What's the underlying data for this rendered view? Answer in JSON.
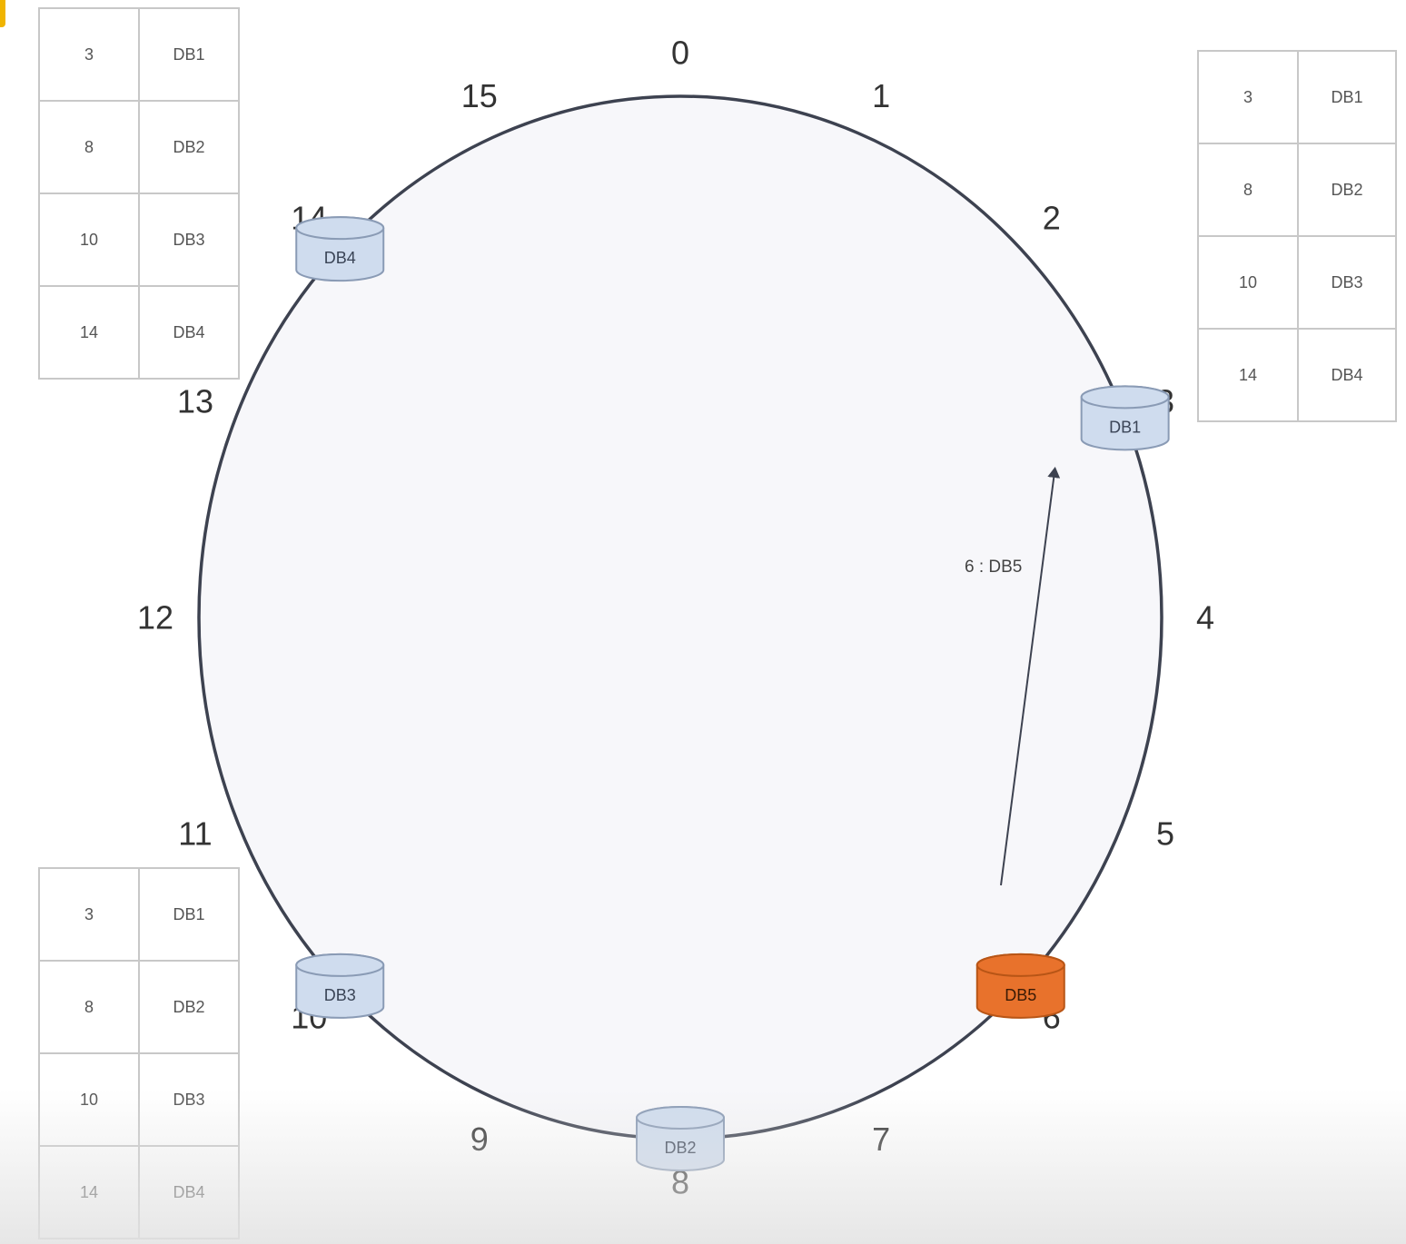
{
  "ring": {
    "positions": [
      "0",
      "1",
      "2",
      "3",
      "4",
      "5",
      "6",
      "7",
      "8",
      "9",
      "10",
      "11",
      "12",
      "13",
      "14",
      "15"
    ],
    "ring_size": 16
  },
  "nodes": [
    {
      "label": "DB1",
      "position": 3,
      "highlighted": false
    },
    {
      "label": "DB2",
      "position": 8,
      "highlighted": false
    },
    {
      "label": "DB3",
      "position": 10,
      "highlighted": false
    },
    {
      "label": "DB4",
      "position": 14,
      "highlighted": false
    },
    {
      "label": "DB5",
      "position": 6,
      "highlighted": true
    }
  ],
  "arrow": {
    "label": "6 : DB5",
    "from": "DB5",
    "to": "DB1"
  },
  "tables": [
    {
      "id": "top-left",
      "rows": [
        [
          "3",
          "DB1"
        ],
        [
          "8",
          "DB2"
        ],
        [
          "10",
          "DB3"
        ],
        [
          "14",
          "DB4"
        ]
      ]
    },
    {
      "id": "top-right",
      "rows": [
        [
          "3",
          "DB1"
        ],
        [
          "8",
          "DB2"
        ],
        [
          "10",
          "DB3"
        ],
        [
          "14",
          "DB4"
        ]
      ]
    },
    {
      "id": "bottom-left",
      "rows": [
        [
          "3",
          "DB1"
        ],
        [
          "8",
          "DB2"
        ],
        [
          "10",
          "DB3"
        ],
        [
          "14",
          "DB4"
        ]
      ]
    }
  ],
  "colors": {
    "ring_stroke": "#3d4250",
    "ring_fill": "#f7f7fa",
    "node_fill": "#cfdcee",
    "node_stroke": "#8a9bb5",
    "highlight_fill": "#e8722c",
    "highlight_stroke": "#b85516",
    "arrow": "#3d4250",
    "table_border": "#c8c8c8"
  }
}
